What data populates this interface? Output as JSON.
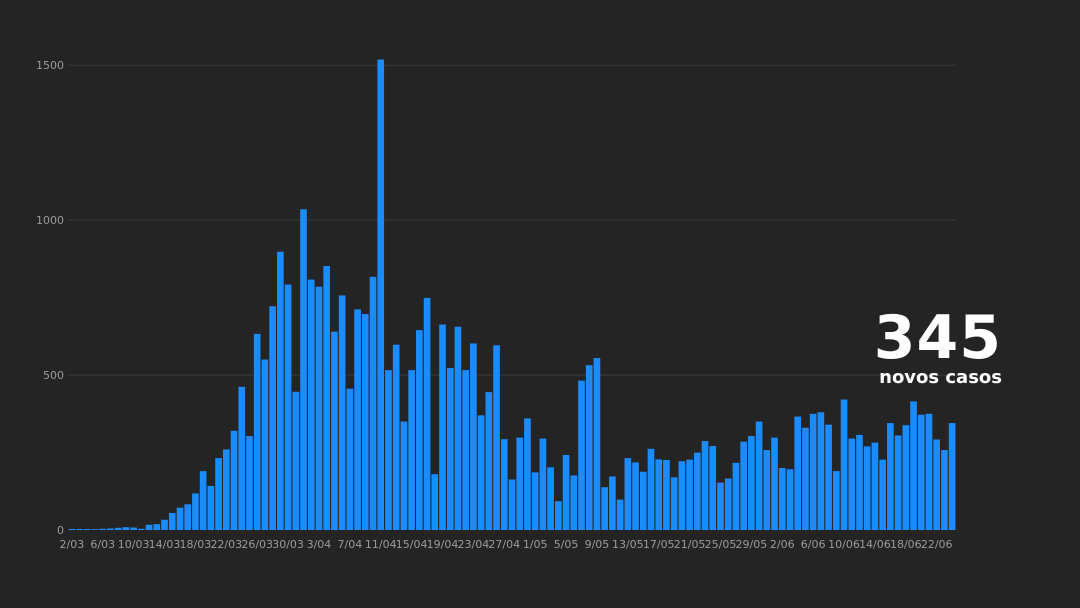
{
  "headline": {
    "value": "345",
    "label": "novos casos"
  },
  "chart_data": {
    "type": "bar",
    "color": "#1a8cff",
    "ylim": [
      0,
      1520
    ],
    "yticks": [
      0,
      500,
      1000,
      1500
    ],
    "xtick_labels": [
      "2/03",
      "6/03",
      "10/03",
      "14/03",
      "18/03",
      "22/03",
      "26/03",
      "30/03",
      "3/04",
      "7/04",
      "11/04",
      "15/04",
      "19/04",
      "23/04",
      "27/04",
      "1/05",
      "5/05",
      "9/05",
      "13/05",
      "17/05",
      "21/05",
      "25/05",
      "29/05",
      "2/06",
      "6/06",
      "10/06",
      "14/06",
      "18/06",
      "22/06"
    ],
    "xtick_every": 4,
    "start_date": "2/03",
    "values": [
      3,
      3,
      3,
      0,
      4,
      5,
      7,
      9,
      8,
      4,
      17,
      19,
      33,
      55,
      72,
      83,
      118,
      190,
      142,
      232,
      260,
      320,
      462,
      303,
      633,
      550,
      722,
      898,
      792,
      446,
      1035,
      808,
      785,
      852,
      640,
      757,
      456,
      712,
      697,
      817,
      1518,
      516,
      598,
      350,
      516,
      645,
      749,
      180,
      663,
      523,
      656,
      516,
      602,
      370,
      445,
      596,
      293,
      163,
      298,
      360,
      186,
      295,
      202,
      93,
      242,
      176,
      482,
      532,
      555,
      138,
      173,
      98,
      232,
      218,
      188,
      262,
      228,
      226,
      170,
      222,
      227,
      250,
      287,
      271,
      153,
      166,
      217,
      285,
      303,
      350,
      258,
      298,
      200,
      196,
      366,
      330,
      375,
      380,
      340,
      190,
      421,
      295,
      307,
      270,
      282,
      227,
      345,
      305,
      338,
      415,
      372,
      375,
      292,
      258,
      345
    ]
  }
}
